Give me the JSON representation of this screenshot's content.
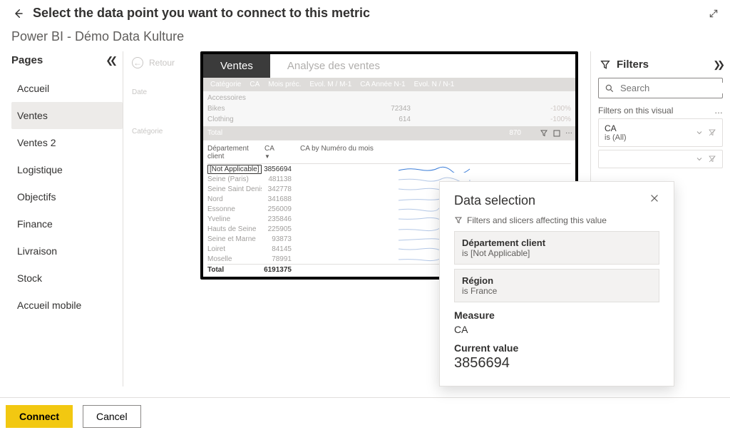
{
  "header": {
    "title": "Select the data point you want to connect to this metric"
  },
  "subheader": "Power BI - Démo Data Kulture",
  "pages": {
    "title": "Pages",
    "items": [
      {
        "label": "Accueil",
        "active": false
      },
      {
        "label": "Ventes",
        "active": true
      },
      {
        "label": "Ventes 2",
        "active": false
      },
      {
        "label": "Logistique",
        "active": false
      },
      {
        "label": "Objectifs",
        "active": false
      },
      {
        "label": "Finance",
        "active": false
      },
      {
        "label": "Livraison",
        "active": false
      },
      {
        "label": "Stock",
        "active": false
      },
      {
        "label": "Accueil mobile",
        "active": false
      }
    ]
  },
  "canvas_back_label": "Retour",
  "report": {
    "tabs": {
      "active": "Ventes",
      "inactive": "Analyse des ventes"
    },
    "grey_headers": [
      "Catégorie",
      "CA",
      "Mois préc.",
      "Evol. M / M-1",
      "CA Année N-1",
      "Evol. N / N-1"
    ],
    "grey_rows": [
      {
        "label": "Accessoires",
        "val": "",
        "pct": ""
      },
      {
        "label": "Bikes",
        "val": "72343",
        "pct": "-100%"
      },
      {
        "label": "Clothing",
        "val": "614",
        "pct": "-100%"
      }
    ],
    "grey_total_label": "Total",
    "grey_total_value": "870",
    "dept_table": {
      "headers": {
        "c1": "Département client",
        "c2": "CA",
        "c3": "CA by Numéro du mois"
      },
      "rows": [
        {
          "name": "[Not Applicable]",
          "val": "3856694",
          "selected": true
        },
        {
          "name": "Seine (Paris)",
          "val": "481138"
        },
        {
          "name": "Seine Saint Denis",
          "val": "342778"
        },
        {
          "name": "Nord",
          "val": "341688"
        },
        {
          "name": "Essonne",
          "val": "256009"
        },
        {
          "name": "Yveline",
          "val": "235846"
        },
        {
          "name": "Hauts de Seine",
          "val": "225905"
        },
        {
          "name": "Seine et Marne",
          "val": "93873"
        },
        {
          "name": "Loiret",
          "val": "84145"
        },
        {
          "name": "Moselle",
          "val": "78991"
        }
      ],
      "total_label": "Total",
      "total_value": "6191375"
    }
  },
  "faded_meta": {
    "date": "Date",
    "categorie": "Catégorie"
  },
  "filters": {
    "title": "Filters",
    "search_placeholder": "Search",
    "section_label": "Filters on this visual",
    "items": [
      {
        "name": "CA",
        "value": "is (All)"
      },
      {
        "name": "",
        "value": ""
      }
    ]
  },
  "popover": {
    "title": "Data selection",
    "sub": "Filters and slicers affecting this value",
    "cards": [
      {
        "label": "Département client",
        "value": "is [Not Applicable]"
      },
      {
        "label": "Région",
        "value": "is France"
      }
    ],
    "measure_label": "Measure",
    "measure_value": "CA",
    "current_label": "Current value",
    "current_value": "3856694"
  },
  "footer": {
    "connect": "Connect",
    "cancel": "Cancel"
  }
}
